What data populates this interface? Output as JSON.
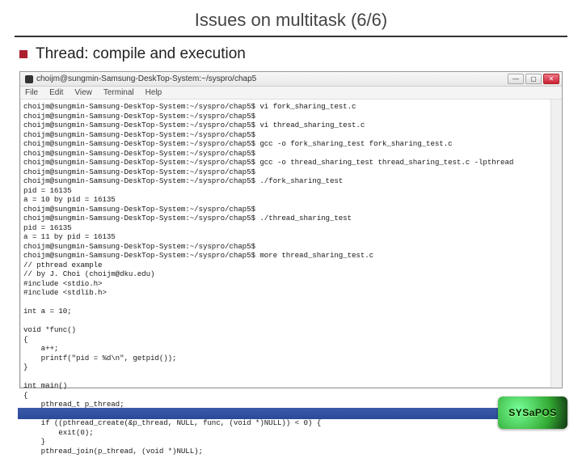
{
  "slide": {
    "title": "Issues on multitask (6/6)",
    "bullet": "Thread: compile and execution"
  },
  "window": {
    "title": "choijm@sungmin-Samsung-DeskTop-System:~/syspro/chap5",
    "menus": [
      "File",
      "Edit",
      "View",
      "Terminal",
      "Help"
    ],
    "buttons": {
      "min": "—",
      "max": "▢",
      "close": "✕"
    }
  },
  "terminal_lines": [
    "choijm@sungmin-Samsung-DeskTop-System:~/syspro/chap5$ vi fork_sharing_test.c",
    "choijm@sungmin-Samsung-DeskTop-System:~/syspro/chap5$",
    "choijm@sungmin-Samsung-DeskTop-System:~/syspro/chap5$ vi thread_sharing_test.c",
    "choijm@sungmin-Samsung-DeskTop-System:~/syspro/chap5$",
    "choijm@sungmin-Samsung-DeskTop-System:~/syspro/chap5$ gcc -o fork_sharing_test fork_sharing_test.c",
    "choijm@sungmin-Samsung-DeskTop-System:~/syspro/chap5$",
    "choijm@sungmin-Samsung-DeskTop-System:~/syspro/chap5$ gcc -o thread_sharing_test thread_sharing_test.c -lpthread",
    "choijm@sungmin-Samsung-DeskTop-System:~/syspro/chap5$",
    "choijm@sungmin-Samsung-DeskTop-System:~/syspro/chap5$ ./fork_sharing_test",
    "pid = 16135",
    "a = 10 by pid = 16135",
    "choijm@sungmin-Samsung-DeskTop-System:~/syspro/chap5$",
    "choijm@sungmin-Samsung-DeskTop-System:~/syspro/chap5$ ./thread_sharing_test",
    "pid = 16135",
    "a = 11 by pid = 16135",
    "choijm@sungmin-Samsung-DeskTop-System:~/syspro/chap5$",
    "choijm@sungmin-Samsung-DeskTop-System:~/syspro/chap5$ more thread_sharing_test.c",
    "// pthread example",
    "// by J. Choi (choijm@dku.edu)",
    "#include <stdio.h>",
    "#include <stdlib.h>",
    "",
    "int a = 10;",
    "",
    "void *func()",
    "{",
    "    a++;",
    "    printf(\"pid = %d\\n\", getpid());",
    "}",
    "",
    "int main()",
    "{",
    "    pthread_t p_thread;",
    "",
    "    if ((pthread_create(&p_thread, NULL, func, (void *)NULL)) < 0) {",
    "        exit(0);",
    "    }",
    "    pthread_join(p_thread, (void *)NULL);"
  ],
  "logo": {
    "text": "SYSaPOS"
  }
}
